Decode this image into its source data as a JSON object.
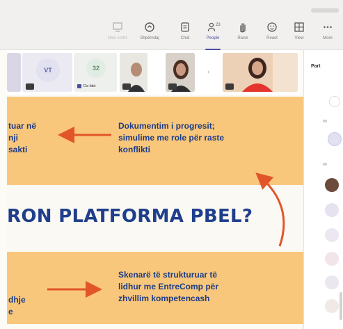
{
  "toolbar": {
    "items": [
      {
        "label": "New sorthi",
        "icon": "whiteboard-icon"
      },
      {
        "label": "Shpërndaj",
        "icon": "share-screen-icon"
      },
      {
        "label": "Chat",
        "icon": "chat-icon"
      },
      {
        "label": "People",
        "icon": "people-icon",
        "count": "23"
      },
      {
        "label": "Raise",
        "icon": "raise-hand-icon"
      },
      {
        "label": "React",
        "icon": "react-icon"
      },
      {
        "label": "View",
        "icon": "view-icon"
      },
      {
        "label": "More",
        "icon": "more-icon"
      }
    ]
  },
  "participants_strip": {
    "tiles": [
      {
        "initials": "VT",
        "badge": "mic-off"
      },
      {
        "initials": "32",
        "name": "Da fabi"
      }
    ]
  },
  "slide": {
    "top_left_lines": [
      "tuar në",
      "nji",
      "sakti"
    ],
    "top_right_lines": [
      "Dokumentim i progresit;",
      "simulime me role për raste",
      "konflikti"
    ],
    "heading": "RON PLATFORMA PBEL?",
    "bottom_right_lines": [
      "Skenarë të strukturuar të",
      "lidhur me EntreComp për",
      "zhvillim kompetencash"
    ],
    "bottom_left_lines": [
      "dhje",
      "e"
    ]
  },
  "panel": {
    "title": "Part"
  },
  "colors": {
    "band": "#f9c77b",
    "text_blue": "#1c3c86",
    "arrow": "#e2552a"
  }
}
